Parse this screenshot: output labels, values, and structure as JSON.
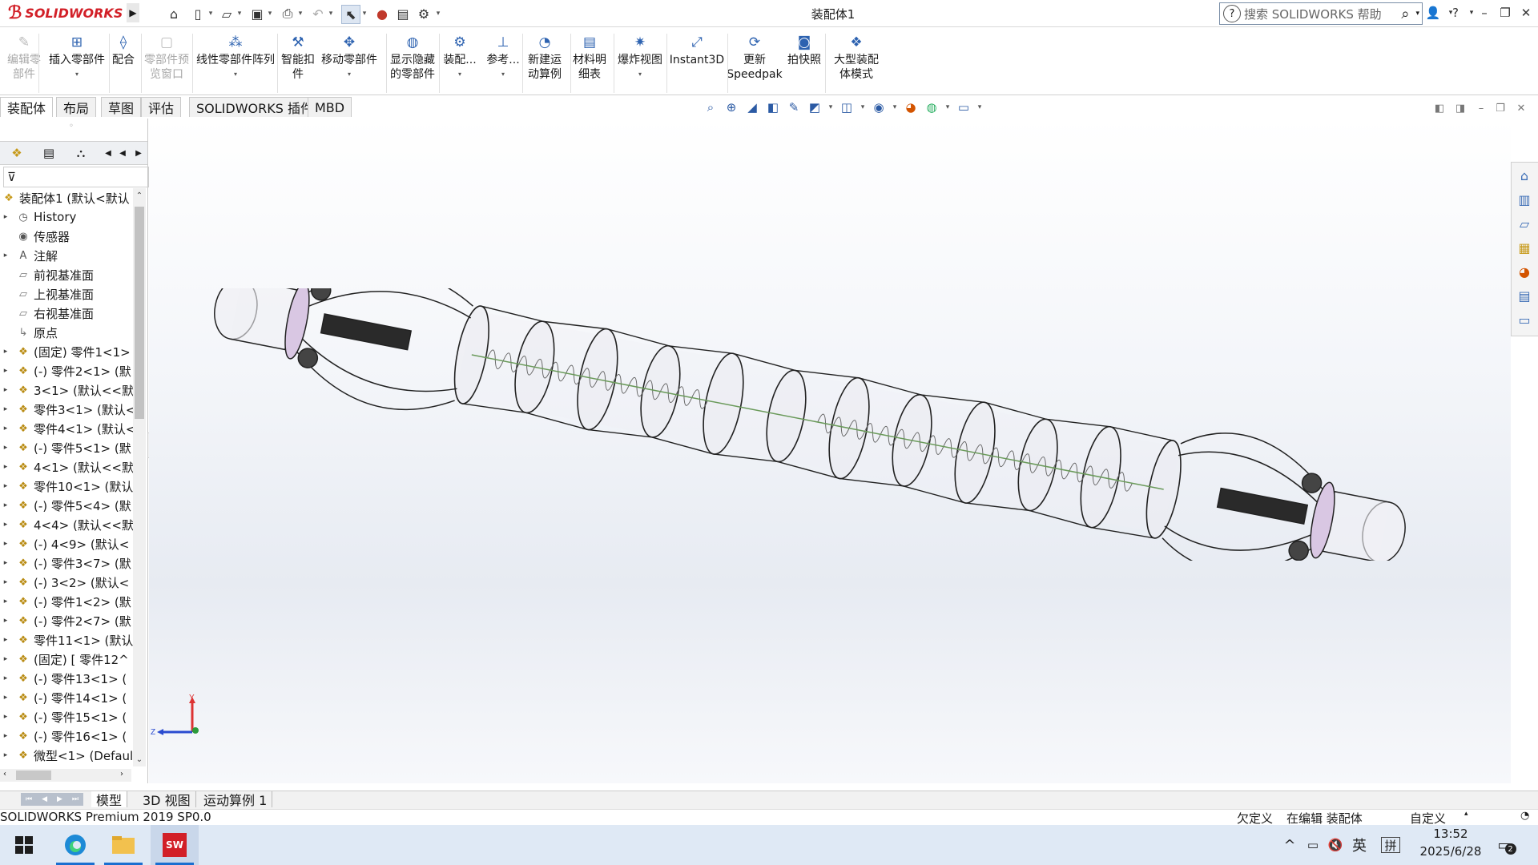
{
  "titlebar": {
    "brand": "SOLIDWORKS",
    "document_title": "装配体1",
    "search_placeholder": "搜索 SOLIDWORKS 帮助",
    "help_label": "?"
  },
  "ribbon": {
    "items": [
      {
        "label": "编辑零\n部件",
        "icon": "edit-component-icon",
        "disabled": true
      },
      {
        "label": "插入零部件",
        "icon": "insert-components-icon",
        "disabled": false
      },
      {
        "label": "配合",
        "icon": "mate-icon",
        "disabled": false
      },
      {
        "label": "零部件预\n览窗口",
        "icon": "component-preview-icon",
        "disabled": true
      },
      {
        "label": "线性零部件阵列",
        "icon": "linear-pattern-icon",
        "disabled": false
      },
      {
        "label": "智能扣\n件",
        "icon": "smart-fasteners-icon",
        "disabled": false
      },
      {
        "label": "移动零部件",
        "icon": "move-component-icon",
        "disabled": false
      },
      {
        "label": "显示隐藏\n的零部件",
        "icon": "show-hidden-icon",
        "disabled": false
      },
      {
        "label": "装配...",
        "icon": "assembly-features-icon",
        "disabled": false
      },
      {
        "label": "参考...",
        "icon": "reference-geometry-icon",
        "disabled": false
      },
      {
        "label": "新建运\n动算例",
        "icon": "new-motion-study-icon",
        "disabled": false
      },
      {
        "label": "材料明\n细表",
        "icon": "bom-icon",
        "disabled": false
      },
      {
        "label": "爆炸视图",
        "icon": "exploded-view-icon",
        "disabled": false
      },
      {
        "label": "Instant3D",
        "icon": "instant3d-icon",
        "disabled": false
      },
      {
        "label": "更新\nSpeedpak",
        "icon": "update-speedpak-icon",
        "disabled": false
      },
      {
        "label": "拍快照",
        "icon": "snapshot-icon",
        "disabled": false
      },
      {
        "label": "大型装配\n体模式",
        "icon": "large-assembly-icon",
        "disabled": false
      }
    ]
  },
  "tabs": [
    "装配体",
    "布局",
    "草图",
    "评估",
    "SOLIDWORKS 插件",
    "MBD"
  ],
  "active_tab": "装配体",
  "feature_tree": {
    "root": "装配体1 (默认<默认",
    "items": [
      {
        "label": "History",
        "expand": true,
        "icon": "history-icon"
      },
      {
        "label": "传感器",
        "expand": false,
        "icon": "sensor-icon"
      },
      {
        "label": "注解",
        "expand": true,
        "icon": "annotations-icon"
      },
      {
        "label": "前视基准面",
        "expand": false,
        "icon": "plane-icon"
      },
      {
        "label": "上视基准面",
        "expand": false,
        "icon": "plane-icon"
      },
      {
        "label": "右视基准面",
        "expand": false,
        "icon": "plane-icon"
      },
      {
        "label": "原点",
        "expand": false,
        "icon": "origin-icon"
      },
      {
        "label": "(固定) 零件1<1>",
        "expand": true,
        "icon": "part-icon"
      },
      {
        "label": "(-) 零件2<1> (默",
        "expand": true,
        "icon": "part-icon"
      },
      {
        "label": "3<1> (默认<<默",
        "expand": true,
        "icon": "part-icon"
      },
      {
        "label": "零件3<1> (默认<",
        "expand": true,
        "icon": "part-icon"
      },
      {
        "label": "零件4<1> (默认<",
        "expand": true,
        "icon": "part-icon"
      },
      {
        "label": "(-) 零件5<1> (默",
        "expand": true,
        "icon": "part-icon"
      },
      {
        "label": "4<1> (默认<<默",
        "expand": true,
        "icon": "part-icon"
      },
      {
        "label": "零件10<1> (默认",
        "expand": true,
        "icon": "part-icon"
      },
      {
        "label": "(-) 零件5<4> (默",
        "expand": true,
        "icon": "part-icon"
      },
      {
        "label": "4<4> (默认<<默",
        "expand": true,
        "icon": "part-icon"
      },
      {
        "label": "(-) 4<9> (默认<",
        "expand": true,
        "icon": "part-icon"
      },
      {
        "label": "(-) 零件3<7> (默",
        "expand": true,
        "icon": "part-icon"
      },
      {
        "label": "(-) 3<2> (默认<",
        "expand": true,
        "icon": "part-icon"
      },
      {
        "label": "(-) 零件1<2> (默",
        "expand": true,
        "icon": "part-icon"
      },
      {
        "label": "(-) 零件2<7> (默",
        "expand": true,
        "icon": "part-icon"
      },
      {
        "label": "零件11<1> (默认",
        "expand": true,
        "icon": "part-icon"
      },
      {
        "label": "(固定) [ 零件12^",
        "expand": true,
        "icon": "part-icon"
      },
      {
        "label": "(-) 零件13<1> (",
        "expand": true,
        "icon": "part-icon"
      },
      {
        "label": "(-) 零件14<1> (",
        "expand": true,
        "icon": "part-icon"
      },
      {
        "label": "(-) 零件15<1> (",
        "expand": true,
        "icon": "part-icon"
      },
      {
        "label": "(-) 零件16<1> (",
        "expand": true,
        "icon": "part-icon"
      },
      {
        "label": "微型<1> (Defaul",
        "expand": true,
        "icon": "part-icon"
      }
    ]
  },
  "triad": {
    "x": "X",
    "y": "Y",
    "z": "Z"
  },
  "bottom_tabs": [
    "模型",
    "3D 视图",
    "运动算例 1"
  ],
  "active_bottom_tab": "模型",
  "statusbar": {
    "product": "SOLIDWORKS Premium 2019 SP0.0",
    "defined": "欠定义",
    "editing": "在编辑 装配体",
    "custom": "自定义"
  },
  "taskbar": {
    "time": "13:52",
    "date": "2025/6/28",
    "ime1": "英",
    "ime2": "拼",
    "notif_count": "2",
    "sw_badge": "SW"
  },
  "colors": {
    "brand_red": "#d21f27",
    "accent_blue": "#1a6fd0",
    "taskbar_bg": "#dfe9f5"
  }
}
